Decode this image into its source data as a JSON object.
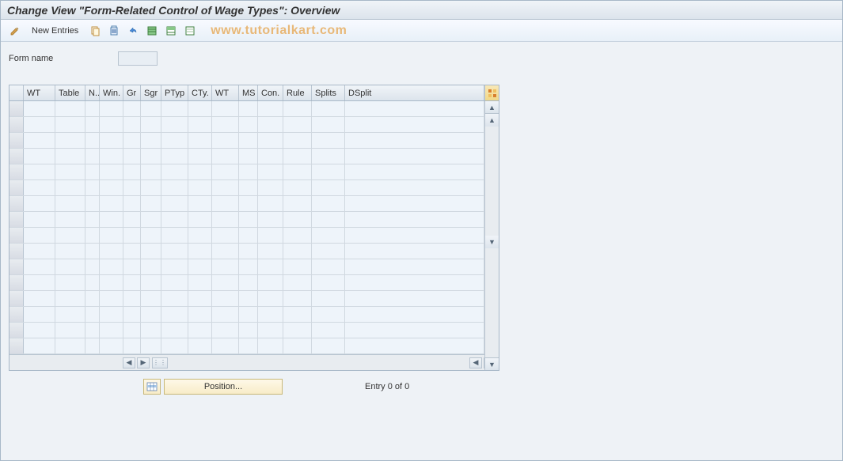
{
  "title": "Change View \"Form-Related Control of Wage Types\": Overview",
  "toolbar": {
    "new_entries_label": "New Entries"
  },
  "watermark": "www.tutorialkart.com",
  "form": {
    "name_label": "Form name",
    "name_value": ""
  },
  "grid": {
    "headers": {
      "wt1": "WT",
      "table": "Table",
      "n": "N..",
      "win": "Win.",
      "gr": "Gr",
      "sgr": "Sgr",
      "ptyp": "PTyp",
      "cty": "CTy.",
      "wt2": "WT",
      "ms": "MS",
      "con": "Con.",
      "rule": "Rule",
      "splits": "Splits",
      "dsplit": "DSplit"
    }
  },
  "footer": {
    "position_label": "Position...",
    "entry_text": "Entry 0 of 0"
  }
}
